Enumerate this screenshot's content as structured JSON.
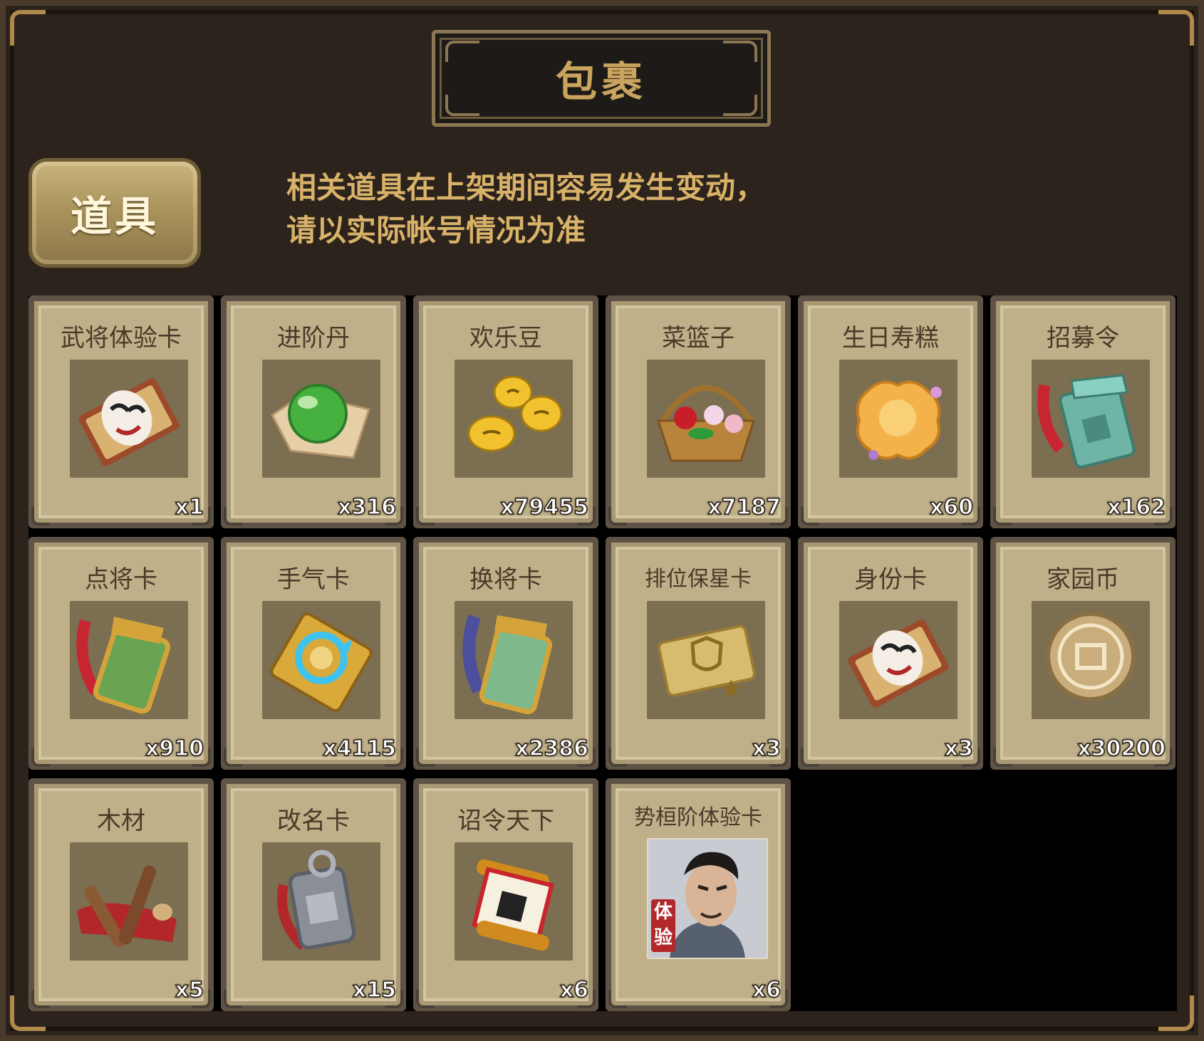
{
  "panel": {
    "title": "包裹"
  },
  "tab": {
    "label": "道具"
  },
  "notice": {
    "line1": "相关道具在上架期间容易发生变动，",
    "line2": "请以实际帐号情况为准"
  },
  "items": [
    {
      "name": "武将体验卡",
      "qty": "x1",
      "icon": "opera-mask-card-icon"
    },
    {
      "name": "进阶丹",
      "qty": "x316",
      "icon": "green-orb-icon"
    },
    {
      "name": "欢乐豆",
      "qty": "x79455",
      "icon": "golden-beans-icon"
    },
    {
      "name": "菜篮子",
      "qty": "x7187",
      "icon": "flower-basket-icon"
    },
    {
      "name": "生日寿糕",
      "qty": "x60",
      "icon": "birthday-cake-icon"
    },
    {
      "name": "招募令",
      "qty": "x162",
      "icon": "jade-token-icon"
    },
    {
      "name": "点将卡",
      "qty": "x910",
      "icon": "general-token-icon"
    },
    {
      "name": "手气卡",
      "qty": "x4115",
      "icon": "refresh-card-icon"
    },
    {
      "name": "换将卡",
      "qty": "x2386",
      "icon": "swap-token-icon"
    },
    {
      "name": "排位保星卡",
      "qty": "x3",
      "icon": "shield-card-icon"
    },
    {
      "name": "身份卡",
      "qty": "x3",
      "icon": "identity-card-icon"
    },
    {
      "name": "家园币",
      "qty": "x30200",
      "icon": "home-coin-icon"
    },
    {
      "name": "木材",
      "qty": "x5",
      "icon": "wood-icon"
    },
    {
      "name": "改名卡",
      "qty": "x15",
      "icon": "rename-tag-icon"
    },
    {
      "name": "诏令天下",
      "qty": "x6",
      "icon": "edict-scroll-icon"
    },
    {
      "name": "势桓阶体验卡",
      "qty": "x6",
      "icon": "hero-portrait-icon",
      "badge": "体验"
    }
  ]
}
